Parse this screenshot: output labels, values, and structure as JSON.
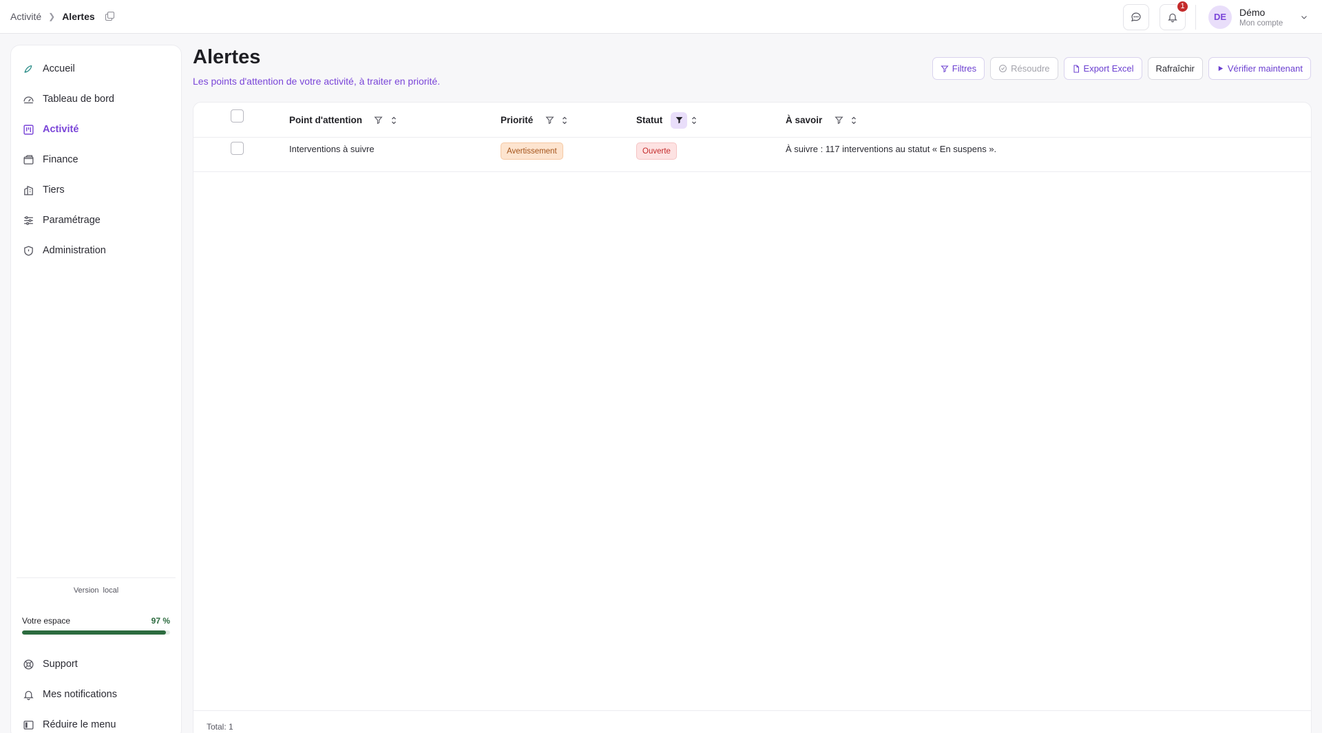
{
  "breadcrumb": {
    "parent": "Activité",
    "current": "Alertes"
  },
  "header": {
    "notification_count": "1",
    "account_initials": "DE",
    "account_name": "Démo",
    "account_sub": "Mon compte"
  },
  "sidebar": {
    "items": [
      {
        "label": "Accueil",
        "icon": "rocket-icon"
      },
      {
        "label": "Tableau de bord",
        "icon": "gauge-icon"
      },
      {
        "label": "Activité",
        "icon": "kanban-icon",
        "active": true
      },
      {
        "label": "Finance",
        "icon": "wallet-icon"
      },
      {
        "label": "Tiers",
        "icon": "building-icon"
      },
      {
        "label": "Paramétrage",
        "icon": "sliders-icon"
      },
      {
        "label": "Administration",
        "icon": "shield-icon"
      }
    ],
    "version_label": "Version",
    "version_value": "local",
    "space_label": "Votre espace",
    "space_percent": "97 %",
    "space_fraction": 0.97,
    "bottom_items": [
      {
        "label": "Support",
        "icon": "lifebuoy-icon"
      },
      {
        "label": "Mes notifications",
        "icon": "bell-icon"
      },
      {
        "label": "Réduire le menu",
        "icon": "sidebar-collapse-icon"
      }
    ]
  },
  "page": {
    "title": "Alertes",
    "subtitle": "Les points d'attention de votre activité, à traiter en priorité."
  },
  "actions": {
    "filters": "Filtres",
    "resolve": "Résoudre",
    "export": "Export Excel",
    "refresh": "Rafraîchir",
    "verify": "Vérifier maintenant"
  },
  "table": {
    "columns": [
      "Point d'attention",
      "Priorité",
      "Statut",
      "À savoir"
    ],
    "rows": [
      {
        "point": "Interventions à suivre",
        "priority": "Avertissement",
        "status": "Ouverte",
        "info": "À suivre : 117 interventions au statut « En suspens »."
      }
    ],
    "total": "Total: 1"
  },
  "colors": {
    "accent": "#7a45d8",
    "success": "#2c6b3f",
    "danger": "#c42b2b",
    "warning": "#a4541b"
  }
}
